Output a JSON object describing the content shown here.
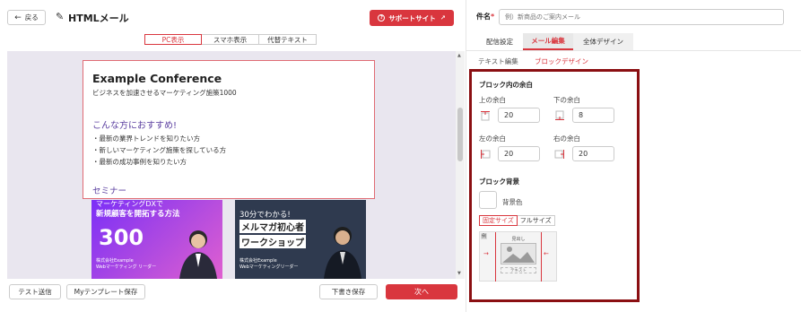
{
  "header": {
    "back_label": "戻る",
    "title": "HTMLメール",
    "support_label": "サポートサイト"
  },
  "view_tabs": [
    "PC表示",
    "スマホ表示",
    "代替テキスト"
  ],
  "preview": {
    "heading": "Example Conference",
    "subheading": "ビジネスを加速させるマーケティング施策1000",
    "section_title": "こんな方におすすめ!",
    "bullets": [
      "・最新の業界トレンドを知りたい方",
      "・新しいマーケティング施策を探している方",
      "・最新の成功事例を知りたい方"
    ],
    "seminar_title": "セミナー",
    "banner1": {
      "line1": "マーケティングDXで",
      "line2": "新規顧客を開拓する方法",
      "big": "300",
      "company": "株式会社Example",
      "dept": "Webマーケティング リーダー"
    },
    "banner2": {
      "line1": "30分でわかる!",
      "line2": "メルマガ初心者",
      "line3": "ワークショップ",
      "company": "株式会社Example",
      "dept": "Webマーケティングリーダー"
    }
  },
  "footer": {
    "test_send": "テスト送信",
    "save_template": "Myテンプレート保存",
    "draft_save": "下書き保存",
    "next": "次へ"
  },
  "right": {
    "subject_label": "件名",
    "subject_required": "*",
    "subject_placeholder": "例）新商品のご案内メール",
    "tabs": [
      "配信設定",
      "メール編集",
      "全体デザイン"
    ],
    "subtabs": [
      "テキスト編集",
      "ブロックデザイン"
    ],
    "padding_title": "ブロック内の余白",
    "top_label": "上の余白",
    "top_value": "20",
    "bottom_label": "下の余白",
    "bottom_value": "8",
    "left_label": "左の余白",
    "left_value": "20",
    "right_label": "右の余白",
    "right_value": "20",
    "bg_title": "ブロック背景",
    "bg_color_label": "背景色",
    "size_options": [
      "固定サイズ",
      "フルサイズ"
    ],
    "example_tag": "例",
    "example_heading": "見出し",
    "example_text": "テキスト"
  },
  "colors": {
    "accent": "#d9363e",
    "highlight_border": "#8b0f12",
    "purple_text": "#5b3fa0"
  }
}
